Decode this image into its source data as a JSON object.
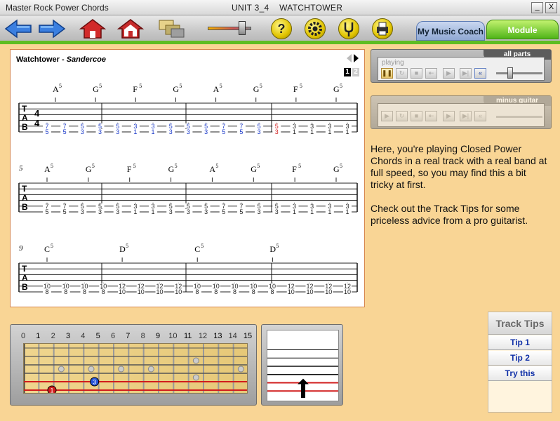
{
  "window": {
    "app_title": "Master Rock Power Chords",
    "unit_title": "UNIT 3_4    WATCHTOWER",
    "minimize_label": "_",
    "close_label": "X"
  },
  "toolbar": {
    "help_label": "?",
    "tabs": {
      "coach": "My Music Coach",
      "module": "Module"
    }
  },
  "score": {
    "song": "Watchtower",
    "separator": " - ",
    "artist": "Sandercoe",
    "pages": [
      "1",
      "2"
    ],
    "current_page": 1,
    "time_signature": [
      "4",
      "4"
    ],
    "tab_label": [
      "T",
      "A",
      "B"
    ],
    "systems": [
      {
        "bar_number": "",
        "chords": [
          {
            "name": "A5",
            "sub": "5"
          },
          {
            "name": "G5"
          },
          {
            "name": "F5"
          },
          {
            "name": "G5"
          },
          {
            "name": "A5"
          },
          {
            "name": "G5"
          },
          {
            "name": "F5"
          },
          {
            "name": "G5"
          }
        ],
        "chord_names": [
          "A",
          "G",
          "F",
          "G",
          "A",
          "G",
          "F",
          "G"
        ],
        "chord_sup": "5",
        "frets": [
          [
            "7",
            "5"
          ],
          [
            "7",
            "5"
          ],
          [
            "5",
            "3"
          ],
          [
            "5",
            "3"
          ],
          [
            "5",
            "3"
          ],
          [
            "3",
            "1"
          ],
          [
            "3",
            "1"
          ],
          [
            "5",
            "3"
          ],
          [
            "5",
            "3"
          ],
          [
            "5",
            "3"
          ],
          [
            "7",
            "5"
          ],
          [
            "7",
            "5"
          ],
          [
            "5",
            "3"
          ],
          [
            "5",
            "3"
          ],
          [
            "3",
            "1"
          ],
          [
            "3",
            "1"
          ],
          [
            "3",
            "1"
          ],
          [
            "3",
            "1"
          ]
        ]
      },
      {
        "bar_number": "5",
        "chord_names": [
          "A",
          "G",
          "F",
          "G",
          "A",
          "G",
          "F",
          "G"
        ],
        "chord_sup": "5",
        "frets": [
          [
            "7",
            "5"
          ],
          [
            "7",
            "5"
          ],
          [
            "5",
            "3"
          ],
          [
            "5",
            "3"
          ],
          [
            "5",
            "3"
          ],
          [
            "3",
            "1"
          ],
          [
            "3",
            "1"
          ],
          [
            "5",
            "3"
          ],
          [
            "5",
            "3"
          ],
          [
            "5",
            "3"
          ],
          [
            "7",
            "5"
          ],
          [
            "7",
            "5"
          ],
          [
            "5",
            "3"
          ],
          [
            "5",
            "3"
          ],
          [
            "3",
            "1"
          ],
          [
            "3",
            "1"
          ],
          [
            "3",
            "1"
          ],
          [
            "3",
            "1"
          ]
        ]
      },
      {
        "bar_number": "9",
        "chord_names": [
          "C",
          "D",
          "C",
          "D"
        ],
        "chord_sup": "5",
        "frets": [
          [
            "10",
            "8"
          ],
          [
            "10",
            "8"
          ],
          [
            "10",
            "8"
          ],
          [
            "10",
            "8"
          ],
          [
            "12",
            "10"
          ],
          [
            "12",
            "10"
          ],
          [
            "12",
            "10"
          ],
          [
            "12",
            "10"
          ],
          [
            "10",
            "8"
          ],
          [
            "10",
            "8"
          ],
          [
            "10",
            "8"
          ],
          [
            "10",
            "8"
          ],
          [
            "10",
            "8"
          ],
          [
            "12",
            "10"
          ],
          [
            "12",
            "10"
          ],
          [
            "12",
            "10"
          ],
          [
            "12",
            "10"
          ]
        ]
      }
    ]
  },
  "player_all": {
    "header": "all parts",
    "state_label": "playing",
    "buttons": [
      "pause",
      "loop",
      "stop",
      "to-start",
      "play",
      "record",
      "rewind"
    ]
  },
  "player_minus": {
    "header": "minus guitar",
    "buttons": [
      "play",
      "loop",
      "stop",
      "to-start",
      "play",
      "record",
      "rewind"
    ]
  },
  "description": [
    "Here, you're playing Closed Power Chords in a real track with a real band at full speed, so you may find this a bit tricky at first.",
    "Check out the Track Tips for some priceless advice from a pro guitarist."
  ],
  "fretboard": {
    "fret_numbers": [
      "0",
      "1",
      "2",
      "3",
      "4",
      "5",
      "6",
      "7",
      "8",
      "9",
      "10",
      "11",
      "12",
      "13",
      "14",
      "15"
    ],
    "markers": [
      {
        "fret": "1",
        "label": "1"
      },
      {
        "fret": "3",
        "label": "3"
      }
    ]
  },
  "track_tips": {
    "title": "Track Tips",
    "items": [
      "Tip 1",
      "Tip 2",
      "Try this"
    ]
  },
  "colors": {
    "accent_green": "#5ebd22",
    "tab_blue": "#1a39c9",
    "tab_red": "#d11c1c",
    "panel_border": "#d6864e",
    "background": "#f9d595"
  }
}
